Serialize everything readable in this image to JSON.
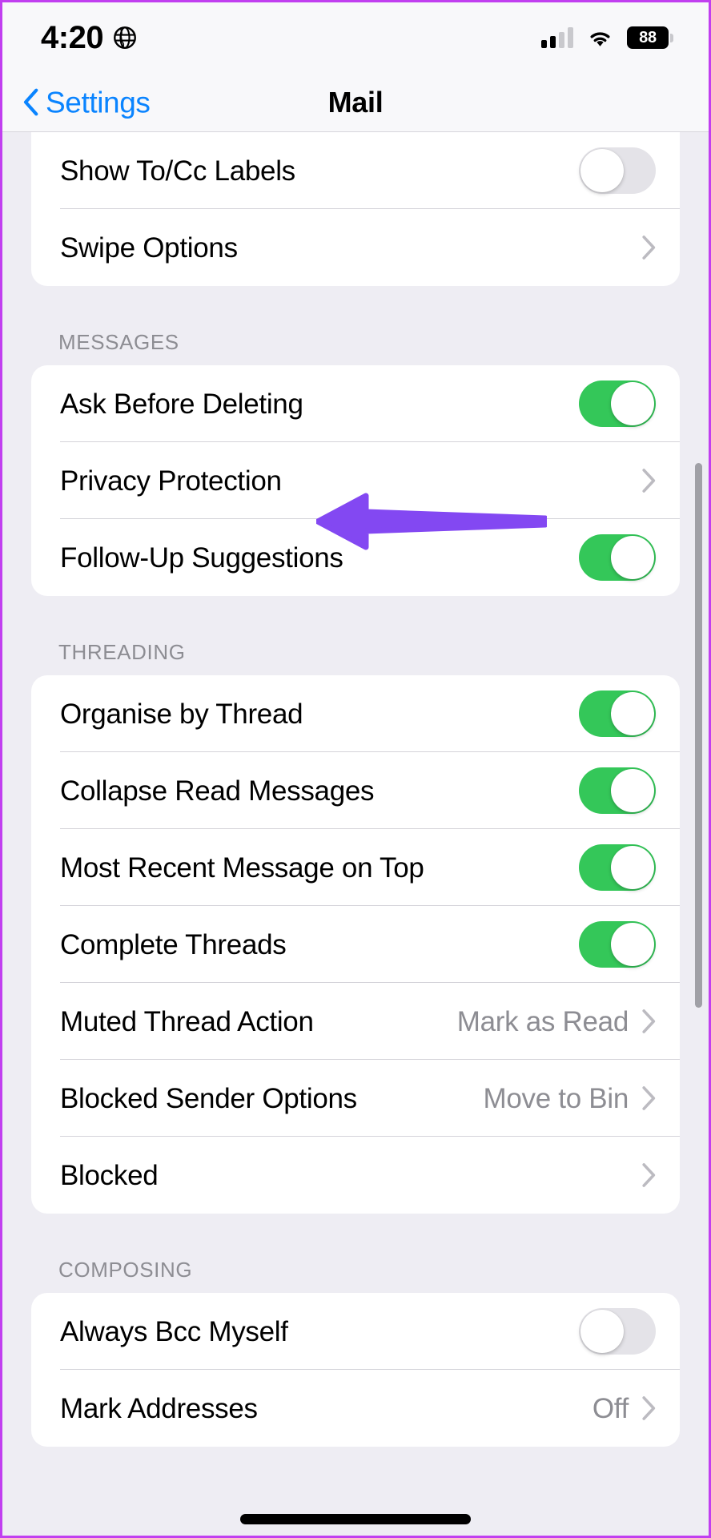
{
  "colors": {
    "accent_blue": "#0a84ff",
    "toggle_on_green": "#34c759",
    "toggle_off_gray": "#e4e3e8",
    "background": "#eeedf3",
    "card": "#ffffff",
    "secondary_text": "#8d8d93",
    "annotation_purple": "#8348f2",
    "frame_purple": "#c13ff0"
  },
  "status_bar": {
    "time": "4:20",
    "location_icon": "globe-icon",
    "signal_icon": "cellular-signal-icon",
    "signal_bars_filled": 2,
    "signal_bars_total": 4,
    "wifi_icon": "wifi-icon",
    "battery_icon": "battery-icon",
    "battery_level": "88"
  },
  "nav_bar": {
    "back_icon": "chevron-left-icon",
    "back_label": "Settings",
    "title": "Mail"
  },
  "groups": [
    {
      "id": "viewing-partial",
      "header": "",
      "clipped_top": true,
      "rows": [
        {
          "label": "Show To/Cc Labels",
          "control": "toggle",
          "value": "off"
        },
        {
          "label": "Swipe Options",
          "control": "chevron",
          "value": ""
        }
      ]
    },
    {
      "id": "messages",
      "header": "MESSAGES",
      "clipped_top": false,
      "rows": [
        {
          "label": "Ask Before Deleting",
          "control": "toggle",
          "value": "on"
        },
        {
          "label": "Privacy Protection",
          "control": "chevron",
          "value": ""
        },
        {
          "label": "Follow-Up Suggestions",
          "control": "toggle",
          "value": "on"
        }
      ]
    },
    {
      "id": "threading",
      "header": "THREADING",
      "clipped_top": false,
      "rows": [
        {
          "label": "Organise by Thread",
          "control": "toggle",
          "value": "on"
        },
        {
          "label": "Collapse Read Messages",
          "control": "toggle",
          "value": "on"
        },
        {
          "label": "Most Recent Message on Top",
          "control": "toggle",
          "value": "on"
        },
        {
          "label": "Complete Threads",
          "control": "toggle",
          "value": "on"
        },
        {
          "label": "Muted Thread Action",
          "control": "chevron",
          "value": "Mark as Read"
        },
        {
          "label": "Blocked Sender Options",
          "control": "chevron",
          "value": "Move to Bin"
        },
        {
          "label": "Blocked",
          "control": "chevron",
          "value": ""
        }
      ]
    },
    {
      "id": "composing",
      "header": "COMPOSING",
      "clipped_top": false,
      "rows": [
        {
          "label": "Always Bcc Myself",
          "control": "toggle",
          "value": "off"
        },
        {
          "label": "Mark Addresses",
          "control": "chevron",
          "value": "Off"
        }
      ]
    }
  ],
  "annotation": {
    "type": "arrow",
    "direction": "left",
    "points_at": "Privacy Protection",
    "color": "#8348f2"
  }
}
